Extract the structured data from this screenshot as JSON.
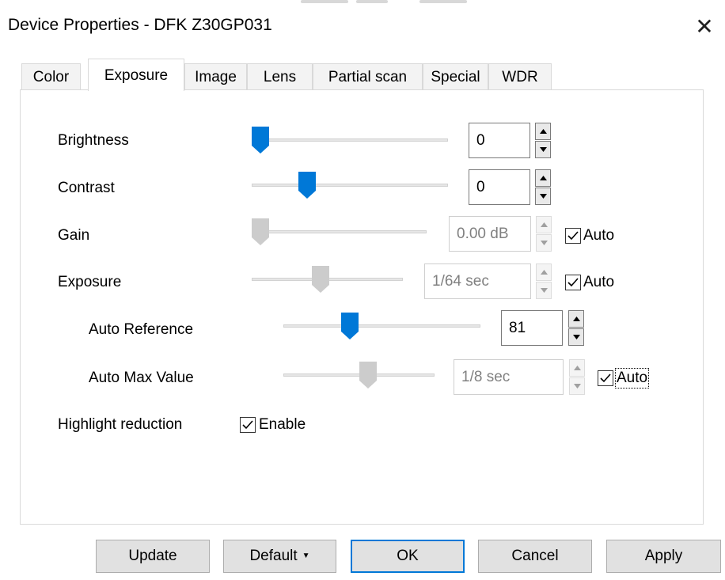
{
  "window": {
    "title": "Device Properties - DFK Z30GP031",
    "close_icon": "close-icon"
  },
  "tabs": [
    {
      "label": "Color"
    },
    {
      "label": "Exposure",
      "active": true
    },
    {
      "label": "Image"
    },
    {
      "label": "Lens"
    },
    {
      "label": "Partial scan"
    },
    {
      "label": "Special"
    },
    {
      "label": "WDR"
    }
  ],
  "controls": {
    "brightness": {
      "label": "Brightness",
      "value": "0",
      "slider_fraction": 0.0
    },
    "contrast": {
      "label": "Contrast",
      "value": "0",
      "slider_fraction": 0.26
    },
    "gain": {
      "label": "Gain",
      "value": "0.00 dB",
      "slider_fraction": 0.0,
      "auto_label": "Auto",
      "auto_checked": true,
      "disabled": true
    },
    "exposure": {
      "label": "Exposure",
      "value": "1/64 sec",
      "slider_fraction": 0.45,
      "auto_label": "Auto",
      "auto_checked": true,
      "disabled": true
    },
    "auto_reference": {
      "label": "Auto Reference",
      "value": "81",
      "slider_fraction": 0.32
    },
    "auto_max_value": {
      "label": "Auto Max Value",
      "value": "1/8 sec",
      "slider_fraction": 0.57,
      "auto_label": "Auto",
      "auto_checked": true,
      "disabled": true
    },
    "highlight_reduction": {
      "label": "Highlight reduction",
      "enable_label": "Enable",
      "enable_checked": true
    }
  },
  "buttons": {
    "update": "Update",
    "default": "Default",
    "ok": "OK",
    "cancel": "Cancel",
    "apply": "Apply"
  },
  "colors": {
    "accent": "#0078d7",
    "thumb_disabled": "#cccccc"
  }
}
